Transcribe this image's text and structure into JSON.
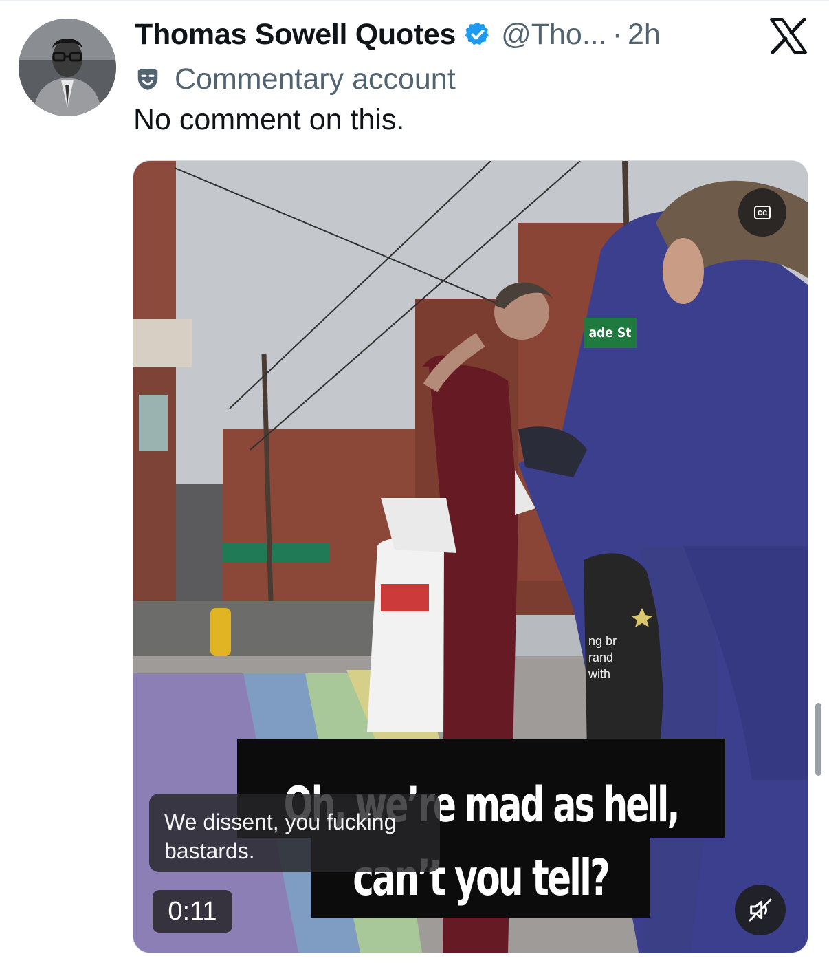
{
  "post": {
    "display_name": "Thomas Sowell Quotes",
    "handle": "@Tho...",
    "separator": "·",
    "time": "2h",
    "label": "Commentary account",
    "text": "No comment on this.",
    "verified_color": "#1d9bf0",
    "logo_icon": "x-logo-icon"
  },
  "video": {
    "cc_label": "cc",
    "street_sign": "ade St",
    "sign_lines": [
      "ng br",
      "rand",
      "with"
    ],
    "burned_line_1": "Oh, we’re mad as hell,",
    "burned_line_2": "can’t you tell?",
    "caption_line_1": "We dissent, you fucking",
    "caption_line_2": "bastards.",
    "timestamp": "0:11",
    "mute_icon": "muted-speaker-icon"
  }
}
